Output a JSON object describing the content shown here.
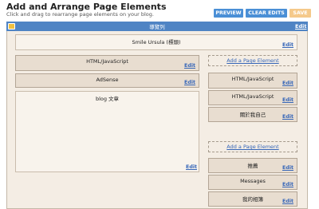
{
  "page": {
    "title": "Add and Arrange Page Elements",
    "subtitle": "Click and drag to rearrange page elements on your blog."
  },
  "toolbar": {
    "preview_label": "PREVIEW",
    "clear_label": "CLEAR EDITS",
    "save_label": "SAVE"
  },
  "header": {
    "label": "導覽列",
    "edit_label": "Edit"
  },
  "blog_title_widget": {
    "title": "Smile Ursula (標頭)",
    "edit_label": "Edit"
  },
  "main_column": {
    "widgets": [
      {
        "title": "HTML/JavaScript",
        "edit_label": "Edit"
      },
      {
        "title": "AdSense",
        "edit_label": "Edit"
      }
    ],
    "posts": {
      "title": "blog 文章",
      "edit_label": "Edit"
    }
  },
  "sidebar": {
    "add_label_top": "Add a Page Element",
    "widgets_top": [
      {
        "title": "HTML/JavaScript",
        "edit_label": "Edit"
      },
      {
        "title": "HTML/JavaScript",
        "edit_label": "Edit"
      },
      {
        "title": "關於我自己",
        "edit_label": "Edit"
      }
    ],
    "add_label_bottom": "Add a Page Element",
    "widgets_bottom": [
      {
        "title": "推薦",
        "edit_label": "Edit"
      },
      {
        "title": "Messages",
        "edit_label": "Edit"
      },
      {
        "title": "我的相簿",
        "edit_label": "Edit"
      }
    ]
  }
}
